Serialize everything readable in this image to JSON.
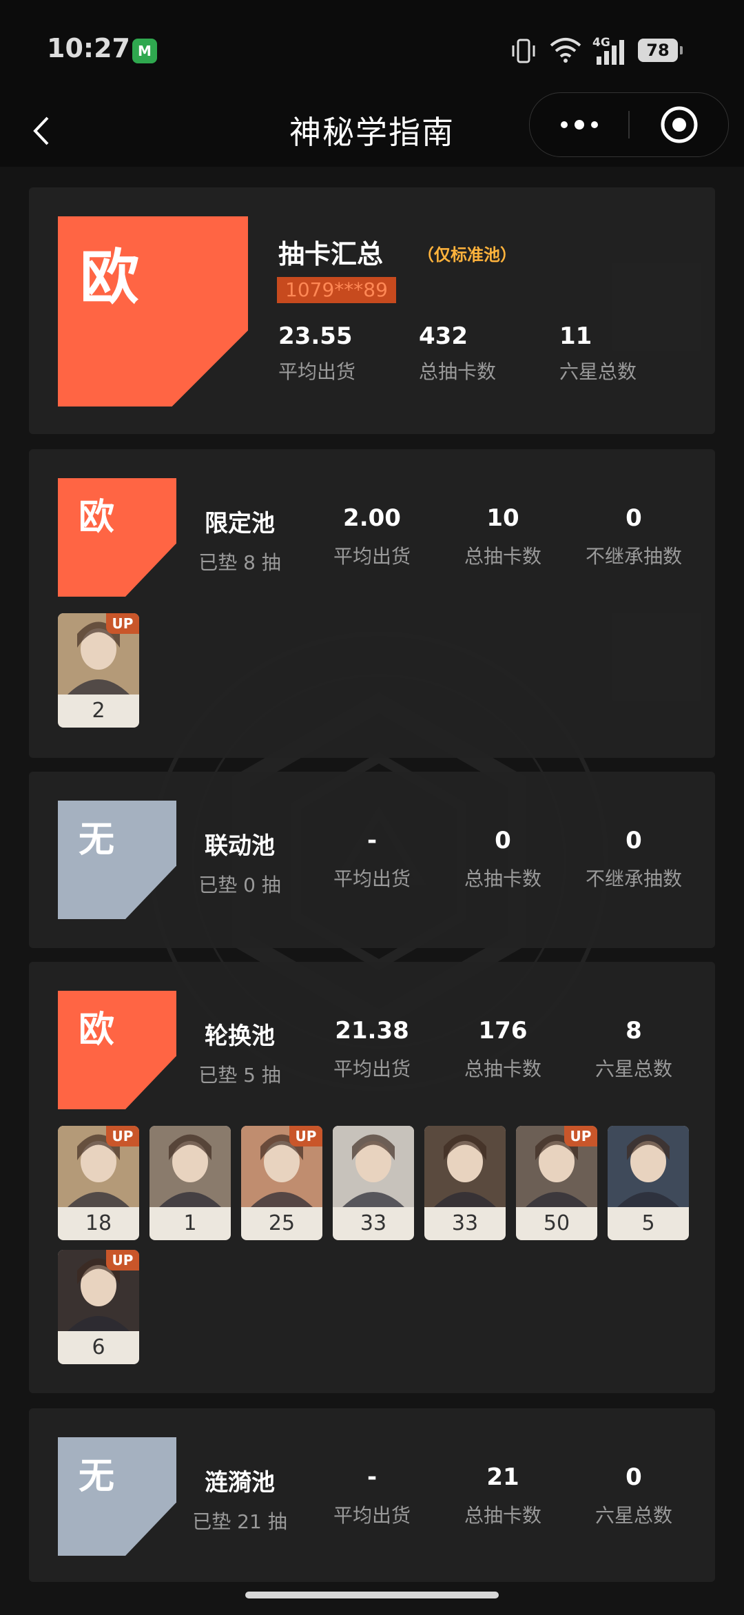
{
  "status_bar": {
    "time": "10:27",
    "network": "4G",
    "battery": "78"
  },
  "nav": {
    "title": "神秘学指南"
  },
  "summary": {
    "badge": "欧",
    "title": "抽卡汇总",
    "note": "（仅标准池）",
    "uid": "1079***89",
    "stats": [
      {
        "value": "23.55",
        "label": "平均出货"
      },
      {
        "value": "432",
        "label": "总抽卡数"
      },
      {
        "value": "11",
        "label": "六星总数"
      }
    ]
  },
  "pools": [
    {
      "badge": "欧",
      "name": "限定池",
      "pity": "已垫 8 抽",
      "stats": [
        {
          "value": "2.00",
          "label": "平均出货"
        },
        {
          "value": "10",
          "label": "总抽卡数"
        },
        {
          "value": "0",
          "label": "不继承抽数"
        }
      ],
      "characters": [
        {
          "count": "2",
          "up": "UP"
        }
      ]
    },
    {
      "badge": "无",
      "name": "联动池",
      "pity": "已垫 0 抽",
      "stats": [
        {
          "value": "-",
          "label": "平均出货"
        },
        {
          "value": "0",
          "label": "总抽卡数"
        },
        {
          "value": "0",
          "label": "不继承抽数"
        }
      ],
      "characters": []
    },
    {
      "badge": "欧",
      "name": "轮换池",
      "pity": "已垫 5 抽",
      "stats": [
        {
          "value": "21.38",
          "label": "平均出货"
        },
        {
          "value": "176",
          "label": "总抽卡数"
        },
        {
          "value": "8",
          "label": "六星总数"
        }
      ],
      "characters": [
        {
          "count": "18",
          "up": "UP"
        },
        {
          "count": "1",
          "up": ""
        },
        {
          "count": "25",
          "up": "UP"
        },
        {
          "count": "33",
          "up": ""
        },
        {
          "count": "33",
          "up": ""
        },
        {
          "count": "50",
          "up": "UP"
        },
        {
          "count": "5",
          "up": ""
        },
        {
          "count": "6",
          "up": "UP"
        }
      ]
    },
    {
      "badge": "无",
      "name": "涟漪池",
      "pity": "已垫 21 抽",
      "stats": [
        {
          "value": "-",
          "label": "平均出货"
        },
        {
          "value": "21",
          "label": "总抽卡数"
        },
        {
          "value": "0",
          "label": "六星总数"
        }
      ],
      "characters": []
    }
  ],
  "colors": {
    "lucky": "#ff6544",
    "none": "#a5b1c0",
    "accent": "#ffb33c",
    "up_tag": "#c9562a"
  }
}
